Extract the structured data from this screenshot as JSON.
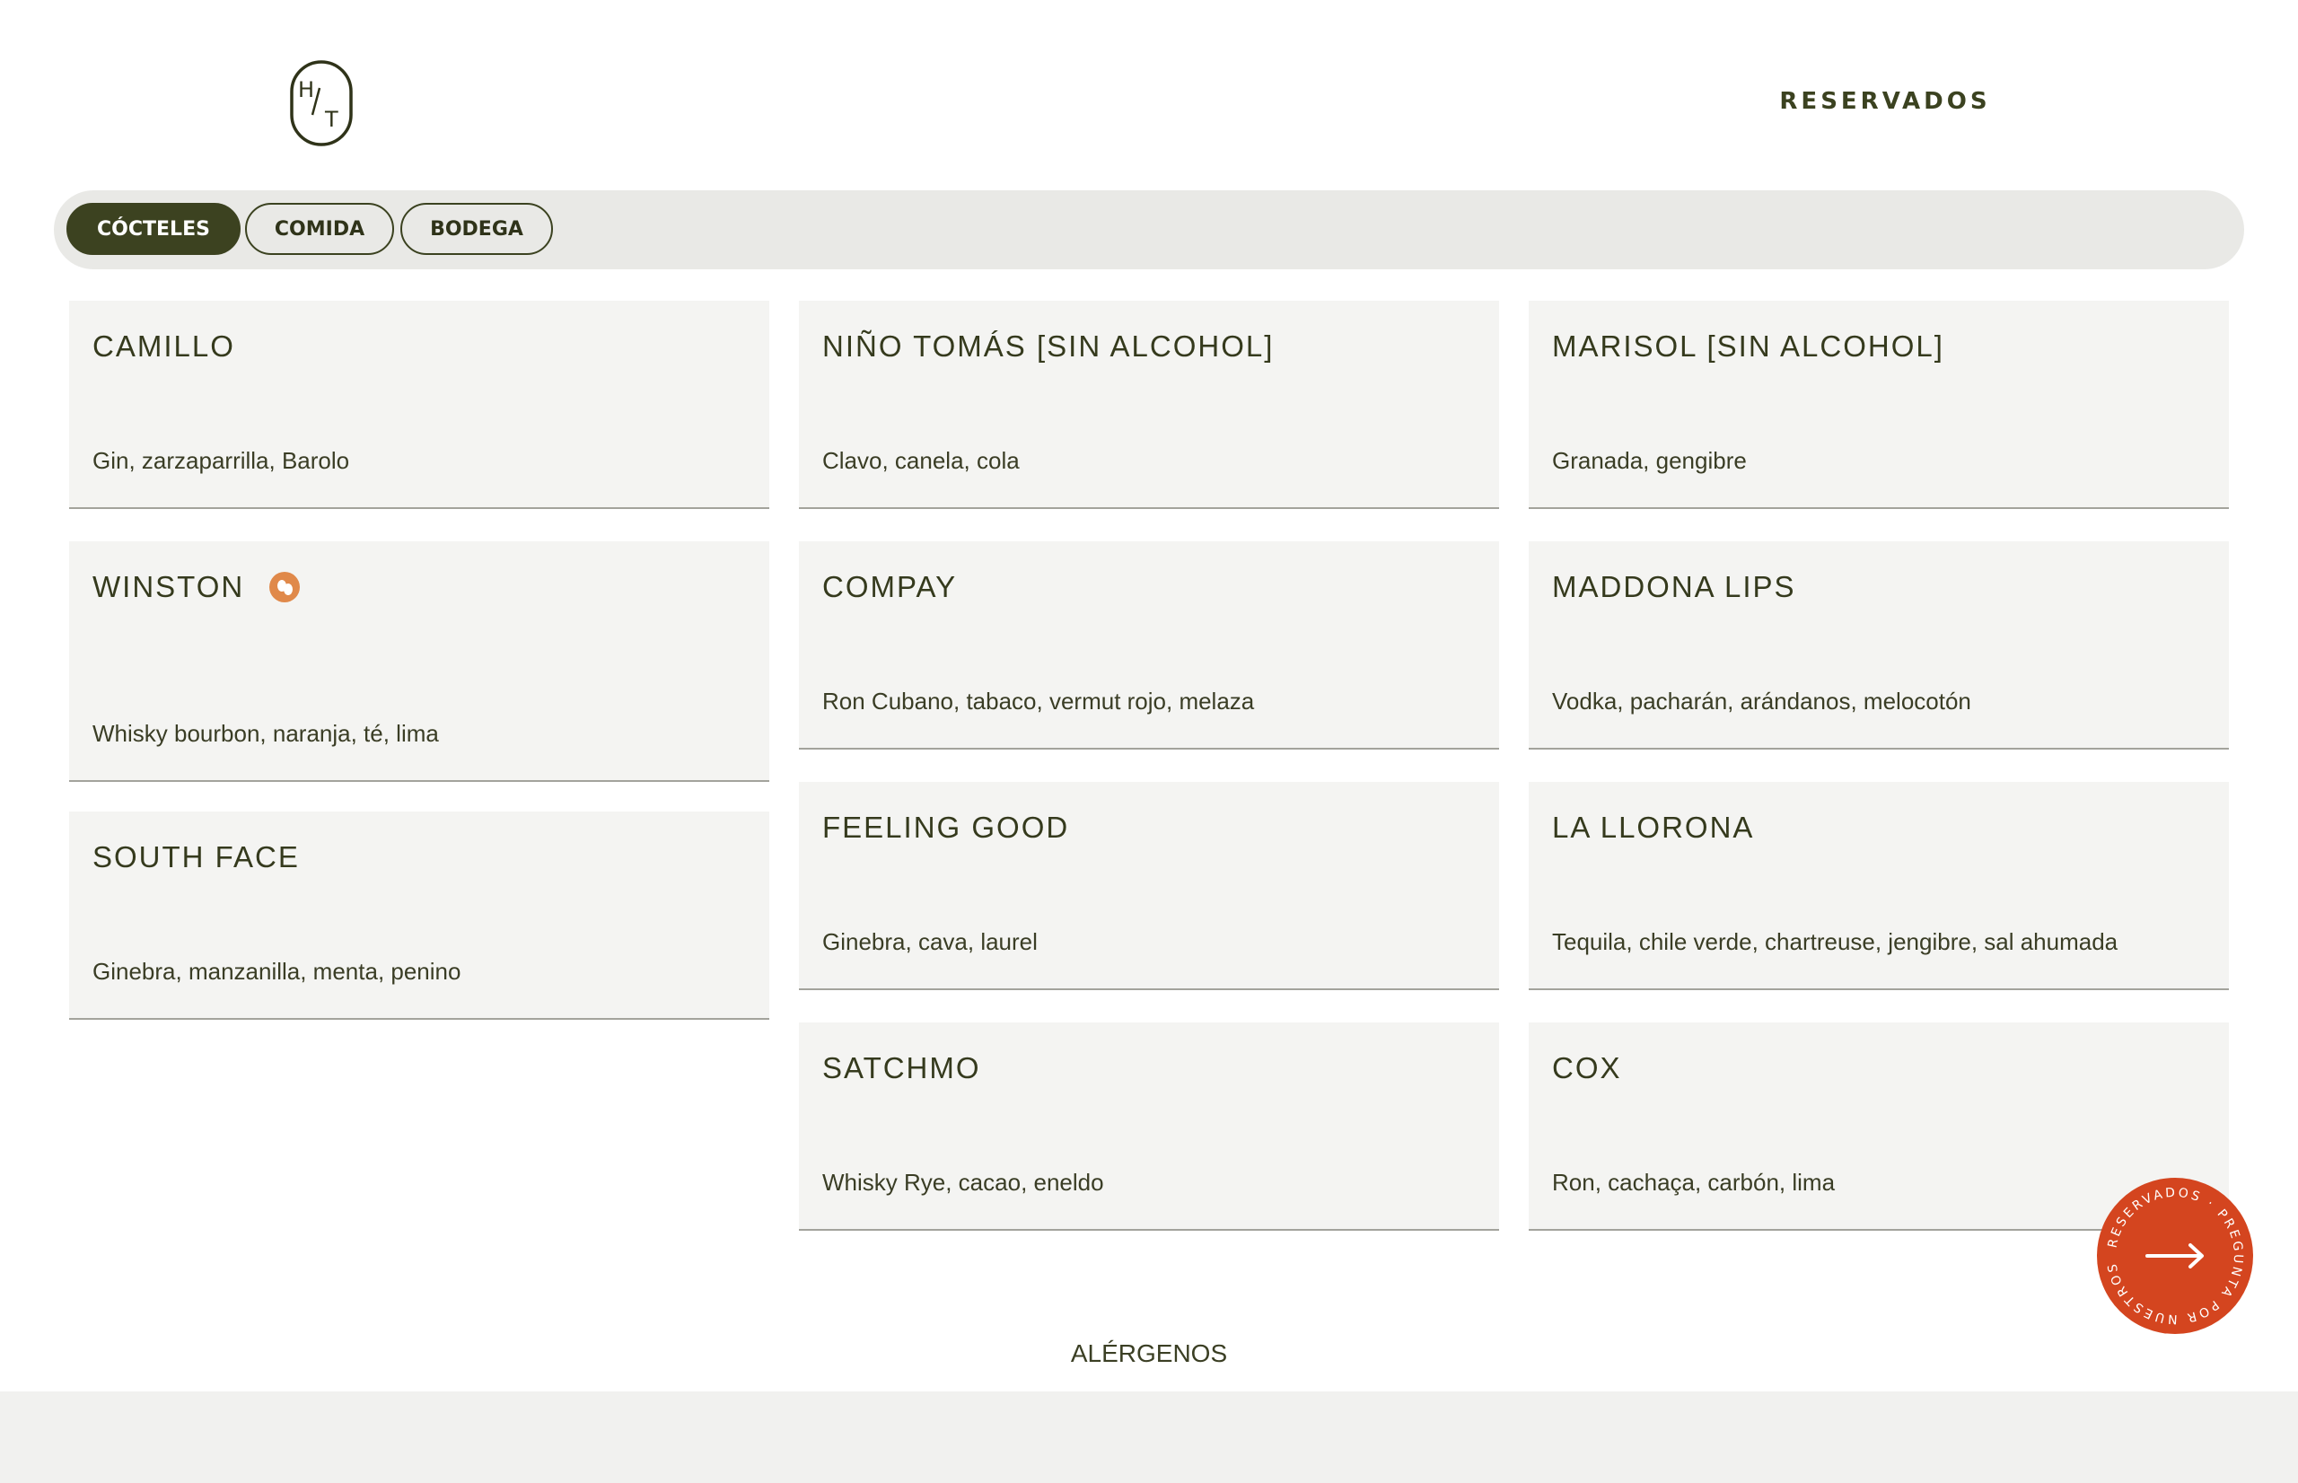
{
  "header": {
    "logo_text": "H/T",
    "reservados_link": "RESERVADOS"
  },
  "tabs": [
    {
      "label": "CÓCTELES",
      "active": true
    },
    {
      "label": "COMIDA",
      "active": false
    },
    {
      "label": "BODEGA",
      "active": false
    }
  ],
  "menu": {
    "items": [
      {
        "name": "CAMILLO",
        "description": "Gin, zarzaparrilla, Barolo"
      },
      {
        "name": "NIÑO TOMÁS [SIN ALCOHOL]",
        "description": "Clavo, canela, cola"
      },
      {
        "name": "MARISOL [SIN ALCOHOL]",
        "description": "Granada, gengibre"
      },
      {
        "name": "WINSTON",
        "description": "Whisky bourbon, naranja, té, lima",
        "allergen_icon": "nuts-icon"
      },
      {
        "name": "COMPAY",
        "description": "Ron Cubano, tabaco, vermut rojo, melaza"
      },
      {
        "name": "MADDONA LIPS",
        "description": "Vodka, pacharán, arándanos, melocotón"
      },
      {
        "name": "SOUTH FACE",
        "description": "Ginebra, manzanilla, menta, penino"
      },
      {
        "name": "FEELING GOOD",
        "description": "Ginebra, cava, laurel"
      },
      {
        "name": "LA LLORONA",
        "description": "Tequila, chile verde, chartreuse, jengibre, sal ahumada"
      },
      {
        "name": "SATCHMO",
        "description": "Whisky Rye, cacao, eneldo"
      },
      {
        "name": "COX",
        "description": "Ron, cachaça, carbón, lima"
      }
    ]
  },
  "footer": {
    "allergens_link": "ALÉRGENOS"
  },
  "fab": {
    "circular_text": "RESERVADOS · PREGUNTA POR NUESTROS",
    "icon": "arrow-right-icon"
  },
  "colors": {
    "accent_dark": "#3c4220",
    "card_bg": "#f4f4f2",
    "tabbar_bg": "#e9e9e6",
    "fab_bg": "#d4451f",
    "allergen_orange": "#e0894a"
  }
}
